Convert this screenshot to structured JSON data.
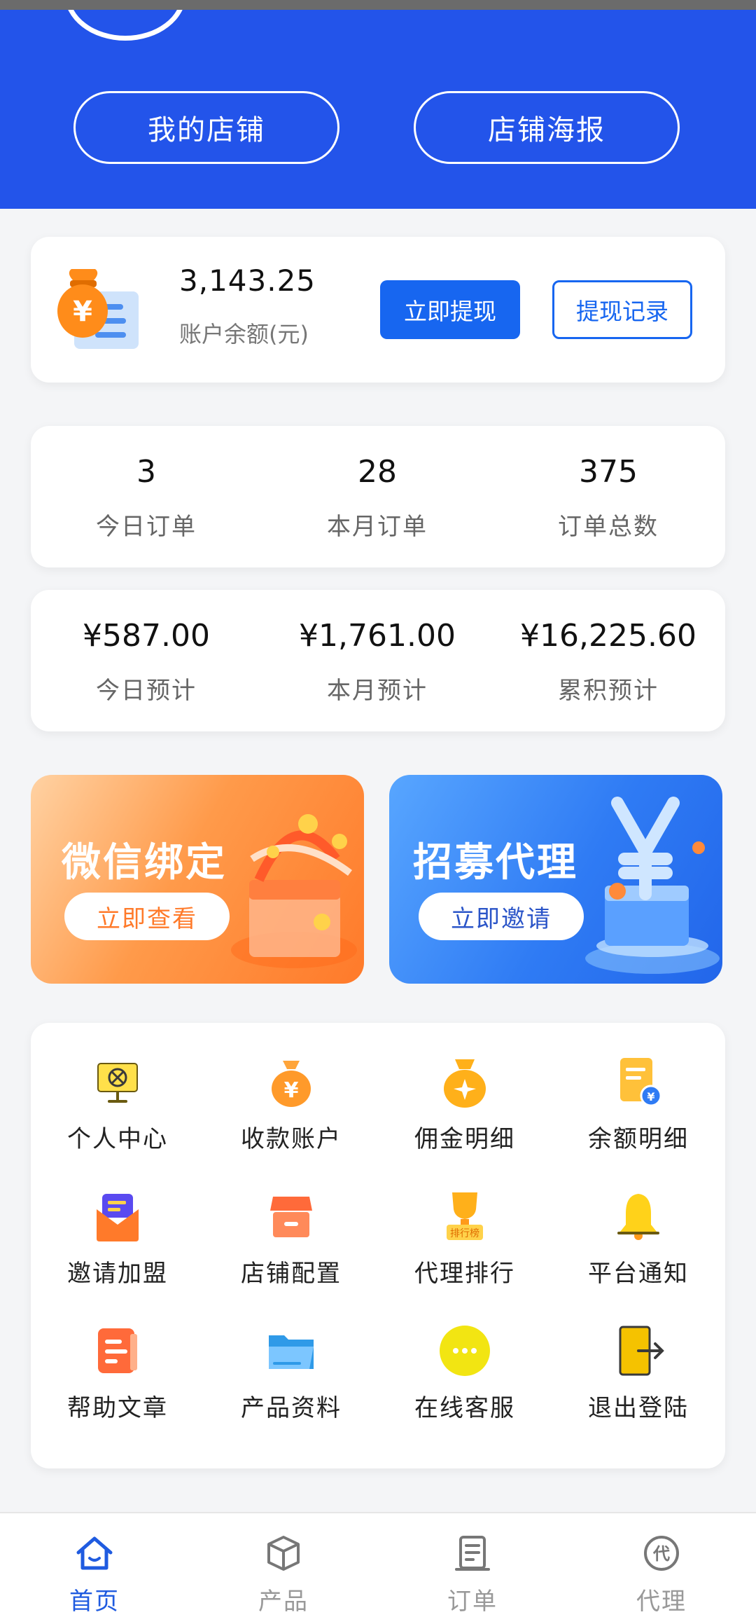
{
  "header": {
    "my_store_label": "我的店铺",
    "store_poster_label": "店铺海报"
  },
  "balance": {
    "amount": "3,143.25",
    "label": "账户余额(元)",
    "withdraw_label": "立即提现",
    "records_label": "提现记录"
  },
  "order_stats": [
    {
      "value": "3",
      "label": "今日订单"
    },
    {
      "value": "28",
      "label": "本月订单"
    },
    {
      "value": "375",
      "label": "订单总数"
    }
  ],
  "estimate_stats": [
    {
      "value": "¥587.00",
      "label": "今日预计"
    },
    {
      "value": "¥1,761.00",
      "label": "本月预计"
    },
    {
      "value": "¥16,225.60",
      "label": "累积预计"
    }
  ],
  "banners": {
    "wechat": {
      "title": "微信绑定",
      "button": "立即查看"
    },
    "recruit": {
      "title": "招募代理",
      "button": "立即邀请"
    }
  },
  "menu": [
    {
      "label": "个人中心",
      "icon": "personal-center-icon"
    },
    {
      "label": "收款账户",
      "icon": "money-bag-icon"
    },
    {
      "label": "佣金明细",
      "icon": "commission-bag-icon"
    },
    {
      "label": "余额明细",
      "icon": "balance-document-icon"
    },
    {
      "label": "邀请加盟",
      "icon": "invite-envelope-icon"
    },
    {
      "label": "店铺配置",
      "icon": "store-icon"
    },
    {
      "label": "代理排行",
      "icon": "trophy-icon",
      "icon_text": "排行榜"
    },
    {
      "label": "平台通知",
      "icon": "bell-icon"
    },
    {
      "label": "帮助文章",
      "icon": "article-icon"
    },
    {
      "label": "产品资料",
      "icon": "folder-icon"
    },
    {
      "label": "在线客服",
      "icon": "chat-bubble-icon"
    },
    {
      "label": "退出登陆",
      "icon": "logout-icon"
    }
  ],
  "tabs": [
    {
      "label": "首页",
      "icon": "home-icon",
      "active": true
    },
    {
      "label": "产品",
      "icon": "box-icon",
      "active": false
    },
    {
      "label": "订单",
      "icon": "receipt-icon",
      "active": false
    },
    {
      "label": "代理",
      "icon": "agent-icon",
      "icon_text": "代",
      "active": false
    }
  ],
  "colors": {
    "brand_blue": "#2354ea",
    "button_blue": "#1766f0",
    "active_tab": "#1f5be0",
    "orange": "#ff7a2a"
  }
}
